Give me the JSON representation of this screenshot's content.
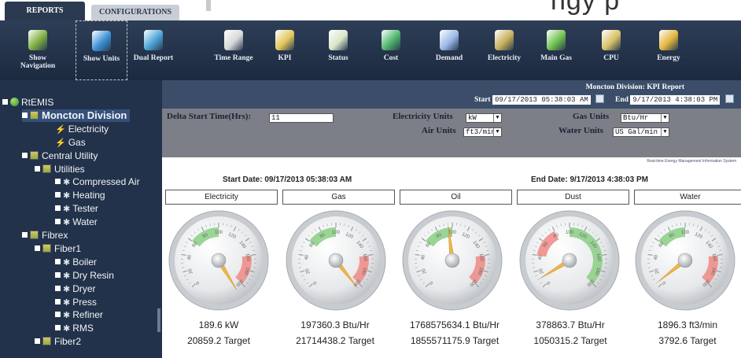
{
  "tabs": [
    {
      "label": "REPORTS",
      "active": true
    },
    {
      "label": "CONFIGURATIONS",
      "active": false
    }
  ],
  "banner_text": "ngy p",
  "toolbar": [
    {
      "label": "Show Navigation",
      "icon": "navigation-icon",
      "color": "#7fae3f"
    },
    {
      "label": "Show Units",
      "icon": "units-icon",
      "color": "#3c8fd6"
    },
    {
      "label": "Dual Report",
      "icon": "dual-report-icon",
      "color": "#4ba3d8"
    },
    {
      "label": "Time Range",
      "icon": "clock-icon",
      "color": "#d8d8d8"
    },
    {
      "label": "KPI",
      "icon": "kpi-gauge-icon",
      "color": "#e2c65a"
    },
    {
      "label": "Status",
      "icon": "status-icon",
      "color": "#d8e6c7"
    },
    {
      "label": "Cost",
      "icon": "cost-icon",
      "color": "#4fb66b"
    },
    {
      "label": "Demand",
      "icon": "demand-icon",
      "color": "#9bb8e8"
    },
    {
      "label": "Electricity",
      "icon": "electricity-icon",
      "color": "#c8b05a"
    },
    {
      "label": "Main Gas",
      "icon": "gas-icon",
      "color": "#6fc24d"
    },
    {
      "label": "CPU",
      "icon": "cpu-icon",
      "color": "#d9c267"
    },
    {
      "label": "Energy",
      "icon": "energy-icon",
      "color": "#e3b43d"
    }
  ],
  "tree": [
    {
      "label": "RtEMIS",
      "level": 0,
      "kind": "root"
    },
    {
      "label": "Moncton Division",
      "level": 1,
      "kind": "folder",
      "selected": true
    },
    {
      "label": "Electricity",
      "level": 2,
      "kind": "bolt"
    },
    {
      "label": "Gas",
      "level": 2,
      "kind": "bolt"
    },
    {
      "label": "Central Utility",
      "level": 1,
      "kind": "folder"
    },
    {
      "label": "Utilities",
      "level": 2,
      "kind": "folder"
    },
    {
      "label": "Compressed Air",
      "level": 3,
      "kind": "cog"
    },
    {
      "label": "Heating",
      "level": 3,
      "kind": "cog"
    },
    {
      "label": "Tester",
      "level": 3,
      "kind": "cog"
    },
    {
      "label": "Water",
      "level": 3,
      "kind": "cog"
    },
    {
      "label": "Fibrex",
      "level": 1,
      "kind": "folder"
    },
    {
      "label": "Fiber1",
      "level": 2,
      "kind": "folder"
    },
    {
      "label": "Boiler",
      "level": 3,
      "kind": "cog"
    },
    {
      "label": "Dry Resin",
      "level": 3,
      "kind": "cog"
    },
    {
      "label": "Dryer",
      "level": 3,
      "kind": "cog"
    },
    {
      "label": "Press",
      "level": 3,
      "kind": "cog"
    },
    {
      "label": "Refiner",
      "level": 3,
      "kind": "cog"
    },
    {
      "label": "RMS",
      "level": 3,
      "kind": "cog"
    },
    {
      "label": "Fiber2",
      "level": 2,
      "kind": "folder"
    }
  ],
  "report": {
    "title": "Moncton Division: KPI Report",
    "start_label": "Start",
    "start_value": "09/17/2013 05:38:03 AM",
    "end_label": "End",
    "end_value": "9/17/2013 4:38:03 PM",
    "delta_label": "Delta Start Time(Hrs):",
    "delta_value": "11",
    "elec_units_label": "Electricity Units",
    "elec_units_value": "kW",
    "gas_units_label": "Gas Units",
    "gas_units_value": "Btu/Hr",
    "air_units_label": "Air Units",
    "air_units_value": "ft3/min",
    "water_units_label": "Water Units",
    "water_units_value": "US Gal/min",
    "tiny_caption": "Real-time Energy Management Information System",
    "start_date_text": "Start Date: 09/17/2013 05:38:03 AM",
    "end_date_text": "End Date: 9/17/2013 4:38:03 PM"
  },
  "gauges": [
    {
      "name": "Electricity",
      "value": "189.6 kW",
      "target": "20859.2 Target",
      "needle": 210,
      "green_from": 60,
      "green_to": 100,
      "red_from": 160,
      "red_to": 200
    },
    {
      "name": "Gas",
      "value": "197360.3 Btu/Hr",
      "target": "21714438.2 Target",
      "needle": 205,
      "green_from": 60,
      "green_to": 100,
      "red_from": 160,
      "red_to": 200
    },
    {
      "name": "Oil",
      "value": "1768575634.1 Btu/Hr",
      "target": "1855571175.9 Target",
      "needle": 95,
      "green_from": 60,
      "green_to": 100,
      "red_from": 160,
      "red_to": 200
    },
    {
      "name": "Dust",
      "value": "378863.7 Btu/Hr",
      "target": "1050315.2 Target",
      "needle": 10,
      "green_from": 100,
      "green_to": 200,
      "red_from": 40,
      "red_to": 80
    },
    {
      "name": "Water",
      "value": "1896.3 ft3/min",
      "target": "3792.6 Target",
      "needle": 5,
      "green_from": 60,
      "green_to": 100,
      "red_from": 160,
      "red_to": 200
    }
  ],
  "gauge_ticks": [
    "0",
    "20",
    "40",
    "60",
    "80",
    "100",
    "120",
    "140",
    "160",
    "180",
    "200"
  ]
}
